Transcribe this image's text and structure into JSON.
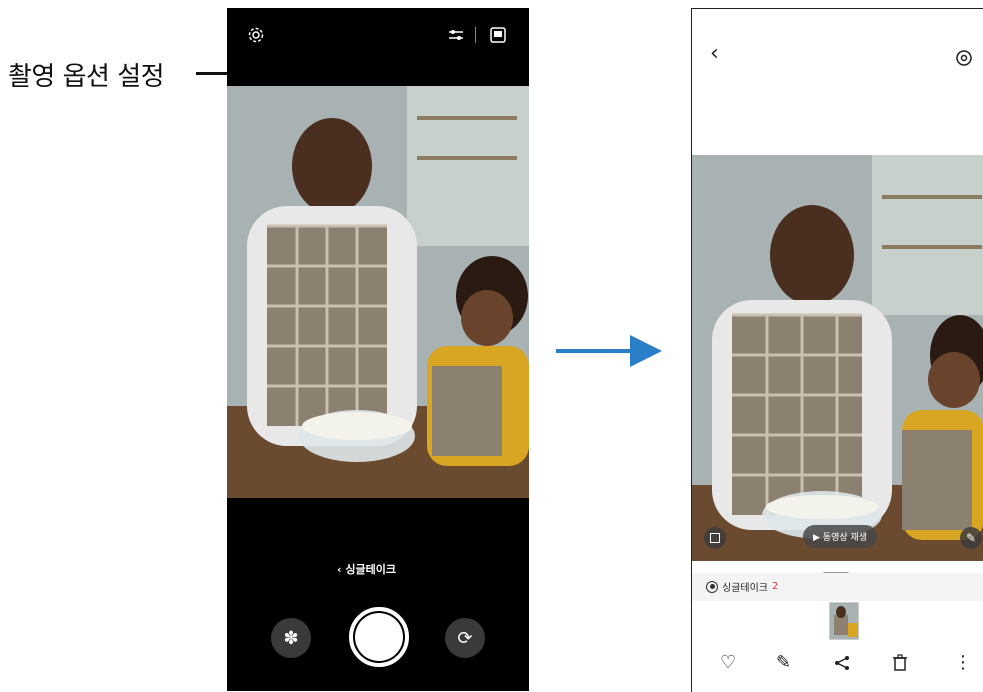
{
  "callout": {
    "label": "촬영 옵션 설정"
  },
  "camera": {
    "mode_label": "싱글테이크"
  },
  "gallery": {
    "play_button": "동영상 재생",
    "singletake_label": "싱글테이크",
    "singletake_count": "2"
  },
  "colors": {
    "arrow": "#2a7fc8",
    "accent_red": "#e0392f"
  }
}
